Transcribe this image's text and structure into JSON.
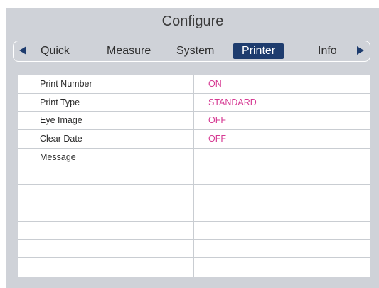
{
  "title": "Configure",
  "tabs": [
    {
      "label": "Quick"
    },
    {
      "label": "Measure"
    },
    {
      "label": "System"
    },
    {
      "label": "Printer"
    },
    {
      "label": "Info"
    }
  ],
  "active_tab": "Printer",
  "settings": [
    {
      "label": "Print Number",
      "value": "ON"
    },
    {
      "label": "Print Type",
      "value": "STANDARD"
    },
    {
      "label": "Eye Image",
      "value": "OFF"
    },
    {
      "label": "Clear Date",
      "value": "OFF"
    },
    {
      "label": "Message",
      "value": ""
    }
  ],
  "colors": {
    "accent": "#1e3c6e",
    "value_text": "#d63a93",
    "panel_background": "#cfd2d8"
  },
  "icons": {
    "prev": "triangle-left-icon",
    "next": "triangle-right-icon"
  }
}
